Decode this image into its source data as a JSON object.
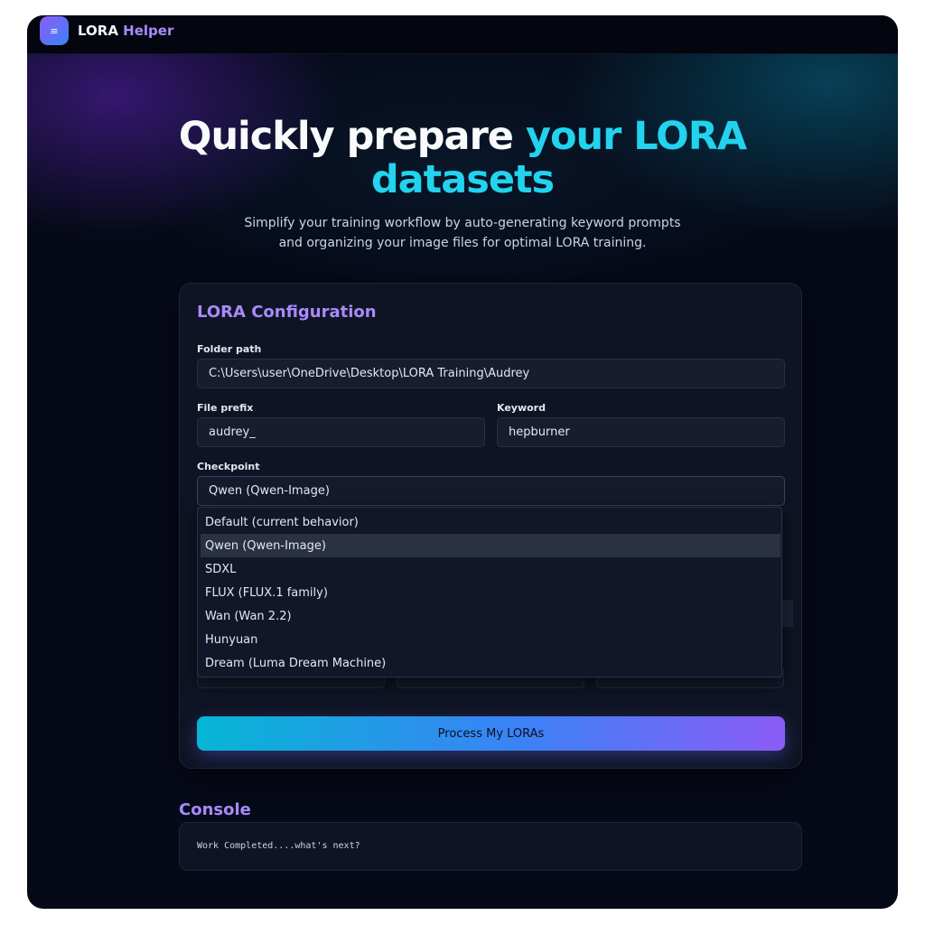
{
  "app": {
    "logo_icon": "≡",
    "brand_part1": "LORA",
    "brand_part2": "Helper"
  },
  "hero": {
    "title_white": "Quickly prepare",
    "title_cyan_1": "your LORA",
    "title_cyan_2": "datasets",
    "subtitle_line1": "Simplify your training workflow by auto-generating keyword prompts",
    "subtitle_line2": "and organizing your image files for optimal LORA training."
  },
  "config": {
    "title": "LORA Configuration",
    "folder_label": "Folder path",
    "folder_value": "C:\\Users\\user\\OneDrive\\Desktop\\LORA Training\\Audrey",
    "prefix_label": "File prefix",
    "prefix_value": "audrey_",
    "keyword_label": "Keyword",
    "keyword_value": "hepburner",
    "checkpoint_label": "Checkpoint",
    "checkpoint_value": "Qwen (Qwen-Image)",
    "checkpoint_options": [
      "Default (current behavior)",
      "Qwen (Qwen-Image)",
      "SDXL",
      "FLUX (FLUX.1 family)",
      "Wan (Wan 2.2)",
      "Hunyuan",
      "Dream (Luma Dream Machine)"
    ],
    "selected_index": 1,
    "process_label": "Process My LORAs"
  },
  "console": {
    "title": "Console",
    "output": "Work Completed....what's next?"
  },
  "colors": {
    "accent_purple": "#a78bfa",
    "accent_cyan": "#22d3ee",
    "background": "#060a18"
  }
}
